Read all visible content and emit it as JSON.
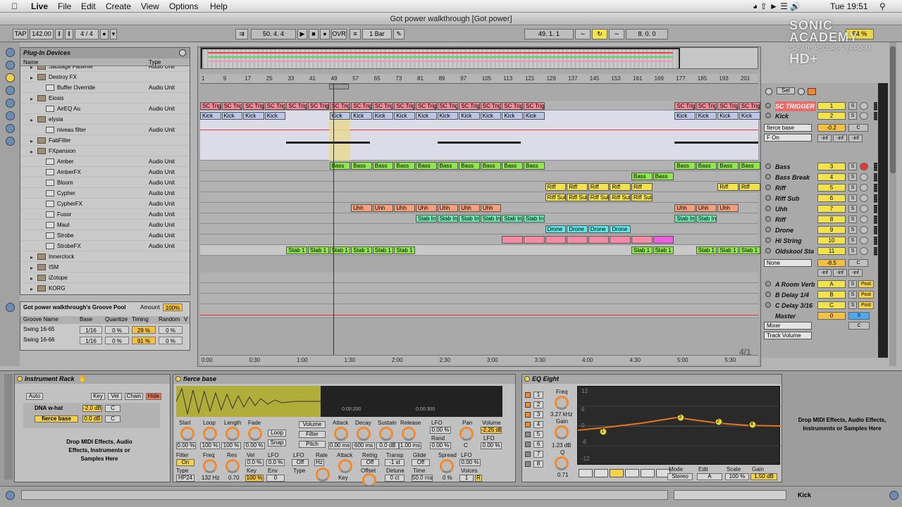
{
  "menu": {
    "app": "Live",
    "items": [
      "File",
      "Edit",
      "Create",
      "View",
      "Options",
      "Help"
    ],
    "clock": "Tue 19:51"
  },
  "window": {
    "title": "Got power walkthrough  [Got power]"
  },
  "transport": {
    "tap": "TAP",
    "tempo": "142.00",
    "signature": "4 / 4",
    "position": "50.  4.  4",
    "ovr": "OVR",
    "quantize": "1 Bar",
    "loop_start": "49.  1.  1",
    "loop_length": "8.  0.  0",
    "cpu": "54 %"
  },
  "browser": {
    "title": "Plug-In Devices",
    "col_name": "Name",
    "col_type": "Type",
    "rows": [
      {
        "d": 1,
        "k": "f",
        "t": "Sausage Fattener",
        "ty": "Audio Unit"
      },
      {
        "d": 1,
        "k": "f",
        "t": "Destroy FX",
        "ty": ""
      },
      {
        "d": 2,
        "k": "p",
        "t": "Buffer Override",
        "ty": "Audio Unit"
      },
      {
        "d": 1,
        "k": "f",
        "t": "Eiosis",
        "ty": ""
      },
      {
        "d": 2,
        "k": "p",
        "t": "AirEQ Au",
        "ty": "Audio Unit"
      },
      {
        "d": 1,
        "k": "f",
        "t": "elysia",
        "ty": ""
      },
      {
        "d": 2,
        "k": "p",
        "t": "niveau filter",
        "ty": "Audio Unit"
      },
      {
        "d": 1,
        "k": "f",
        "t": "FabFilter",
        "ty": ""
      },
      {
        "d": 1,
        "k": "f",
        "t": "FXpansion",
        "ty": ""
      },
      {
        "d": 2,
        "k": "p",
        "t": "Amber",
        "ty": "Audio Unit"
      },
      {
        "d": 2,
        "k": "p",
        "t": "AmberFX",
        "ty": "Audio Unit"
      },
      {
        "d": 2,
        "k": "p",
        "t": "Bloom",
        "ty": "Audio Unit"
      },
      {
        "d": 2,
        "k": "p",
        "t": "Cypher",
        "ty": "Audio Unit"
      },
      {
        "d": 2,
        "k": "p",
        "t": "CypherFX",
        "ty": "Audio Unit"
      },
      {
        "d": 2,
        "k": "p",
        "t": "Fusor",
        "ty": "Audio Unit"
      },
      {
        "d": 2,
        "k": "p",
        "t": "Maul",
        "ty": "Audio Unit"
      },
      {
        "d": 2,
        "k": "p",
        "t": "Strobe",
        "ty": "Audio Unit"
      },
      {
        "d": 2,
        "k": "p",
        "t": "StrobeFX",
        "ty": "Audio Unit"
      },
      {
        "d": 1,
        "k": "f",
        "t": "Innerclock",
        "ty": ""
      },
      {
        "d": 1,
        "k": "f",
        "t": "ISM",
        "ty": ""
      },
      {
        "d": 1,
        "k": "f",
        "t": "iZotope",
        "ty": ""
      },
      {
        "d": 1,
        "k": "f",
        "t": "KORG",
        "ty": ""
      }
    ]
  },
  "groove": {
    "title": "Got power walkthrough's Groove Pool",
    "amount_label": "Amount",
    "amount": "100%",
    "headers": [
      "Groove Name",
      "Base",
      "Quantize",
      "Timing",
      "Random",
      "V"
    ],
    "rows": [
      [
        "Swing 16-65",
        "1/16",
        "0 %",
        "29 %",
        "0 %"
      ],
      [
        "Swing 16-66",
        "1/16",
        "0 %",
        "91 %",
        "0 %"
      ]
    ]
  },
  "ruler": [
    "1",
    "9",
    "17",
    "25",
    "33",
    "41",
    "49",
    "57",
    "65",
    "73",
    "81",
    "89",
    "97",
    "105",
    "113",
    "121",
    "129",
    "137",
    "145",
    "153",
    "161",
    "169",
    "177",
    "185",
    "193",
    "201"
  ],
  "timeline": [
    "0:00",
    "0:30",
    "1:00",
    "1:30",
    "2:00",
    "2:30",
    "3:00",
    "3:30",
    "4:00",
    "4:30",
    "5:00",
    "5:30"
  ],
  "loop_display": "4/1",
  "clip_names": {
    "sc": "SC Trig",
    "kick": "Kick",
    "bass": "Bass",
    "riff": "Riff",
    "riffsub": "Riff Sub",
    "uhh": "Uhh",
    "stab": "Stab 1",
    "drone": "Drone",
    "stabint": "Stab Int"
  },
  "mixer": {
    "set": "Set",
    "tracks": [
      {
        "name": "SC TRIGGER",
        "num": "1"
      },
      {
        "name": "Kick",
        "num": "2",
        "vol": "-0.2",
        "pan": "C",
        "device": "fierce base",
        "route": "F On",
        "meters": [
          "-inf",
          "-inf",
          "-inf"
        ]
      },
      {
        "name": "Bass",
        "num": "3"
      },
      {
        "name": "Bass Break",
        "num": "4"
      },
      {
        "name": "Riff",
        "num": "5"
      },
      {
        "name": "Riff Sub",
        "num": "6"
      },
      {
        "name": "Uhh",
        "num": "7"
      },
      {
        "name": "Riff",
        "num": "8"
      },
      {
        "name": "Drone",
        "num": "9"
      },
      {
        "name": "Hi String",
        "num": "10"
      },
      {
        "name": "Oldskool Sta",
        "num": "11",
        "vol": "-8.5",
        "pan": "C",
        "device": "None",
        "meters": [
          "-inf",
          "-inf",
          "-inf"
        ]
      }
    ],
    "returns": [
      {
        "name": "A Room Verb",
        "num": "A"
      },
      {
        "name": "B Delay 1/4",
        "num": "B"
      },
      {
        "name": "C Delay 3/16",
        "num": "C"
      }
    ],
    "master": {
      "name": "Master",
      "num": "0",
      "cue": "0",
      "pan": "C",
      "mixer": "Mixer",
      "track_volume": "Track Volume"
    },
    "post": "Post",
    "s": "S"
  },
  "rack": {
    "title": "Instrument Rack",
    "auto": "Auto",
    "key": "Key",
    "vel": "Vel",
    "chain": "Chain",
    "hide": "Hide",
    "chains": [
      {
        "name": "DNA w-hat",
        "vol": "-2.0 dB",
        "pan": "C"
      },
      {
        "name": "fierce base",
        "vol": "0.0 dB",
        "pan": "C"
      }
    ],
    "drop": "Drop MIDI Effects, Audio Effects, Instruments or Samples Here"
  },
  "sampler": {
    "title": "fierce base",
    "wave_time1": "0:00:200",
    "wave_time2": "0:00:300",
    "labels": {
      "start": "Start",
      "loop": "Loop",
      "length": "Length",
      "fade": "Fade",
      "volume": "Volume",
      "filter": "Filter",
      "pitch": "Pitch",
      "attack": "Attack",
      "decay": "Decay",
      "sustain": "Sustain",
      "release": "Release",
      "lfo": "LFO",
      "pan": "Pan",
      "rand": "Rand",
      "freq": "Freq",
      "res": "Res",
      "vel": "Vel",
      "key": "Key",
      "env": "Env",
      "type": "Type",
      "rate": "Rate",
      "retrig": "Retrig",
      "offset": "Offset",
      "transp": "Transp",
      "detune": "Detune",
      "glide": "Glide",
      "time": "Time",
      "spread": "Spread",
      "voices": "Voices",
      "hz": "Hz",
      "snap": "Snap"
    },
    "values": {
      "start": "0.00 %",
      "loop": "100 %",
      "length": "100 %",
      "fade": "0.00 %",
      "attack": "0.00 ms",
      "decay": "600 ms",
      "sustain": "0.0 dB",
      "release": "1.00 ms",
      "lfo": "0.00 %",
      "rand": "0.00 %",
      "pan": "C",
      "vol": "-2.25 dB",
      "lfo2": "0.00 %",
      "filter_on": "On",
      "type": "HP24",
      "freq": "132 Hz",
      "res": "0.70",
      "vel": "0.0 %",
      "key": "100 %",
      "lfo3": "0.0 %",
      "env": "0",
      "lfo_off": "Off",
      "transp": "-1 st",
      "detune": "0 ct",
      "glide": "Off",
      "time": "50.0 ms",
      "spread": "0 %",
      "voices": "1",
      "r": "R"
    }
  },
  "eq": {
    "title": "EQ Eight",
    "freq_label": "Freq",
    "freq": "3.27 kHz",
    "gain_label": "Gain",
    "gain": "1.23 dB",
    "q_label": "Q",
    "q": "0.71",
    "bands": [
      "1",
      "2",
      "3",
      "4",
      "5",
      "6",
      "7",
      "8"
    ],
    "mode_label": "Mode",
    "mode": "Stereo",
    "edit_label": "Edit",
    "edit": "A",
    "scale_label": "Scale",
    "scale": "100 %",
    "gain2_label": "Gain",
    "gain2": "1.50 dB",
    "yticks": [
      "12",
      "6",
      "0",
      "-6",
      "-12"
    ],
    "points": [
      "1",
      "3",
      "2",
      "4"
    ]
  },
  "drop2": "Drop MIDI Effects, Audio Effects, Instruments or Samples Here",
  "status": {
    "track": "Kick"
  },
  "watermark": {
    "line1": "SONIC",
    "line2": "ACADEMY",
    "line3": "CREATE. RECORD. PERFORM.",
    "line4": "HD+"
  }
}
